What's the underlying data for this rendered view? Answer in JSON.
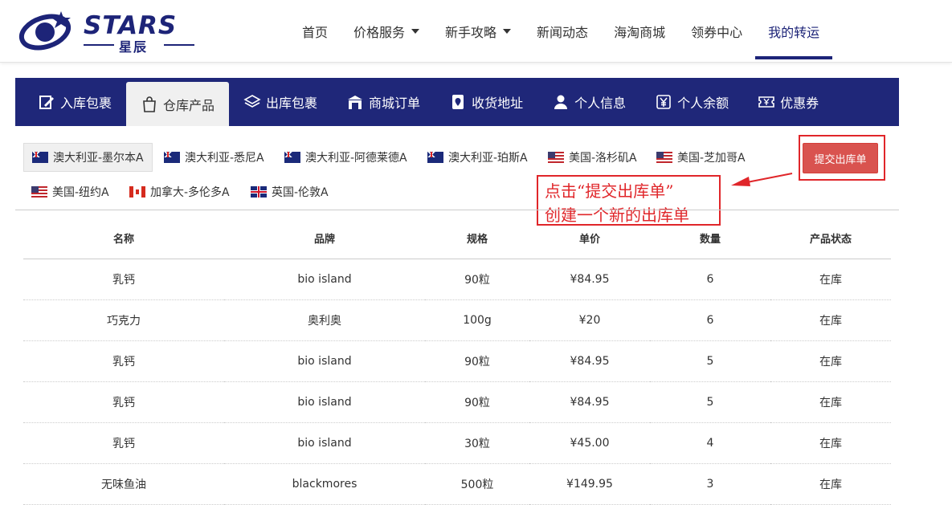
{
  "header": {
    "brand_word": "STARS",
    "brand_cn": "星辰",
    "nav": [
      {
        "label": "首页"
      },
      {
        "label": "价格服务"
      },
      {
        "label": "新手攻略"
      },
      {
        "label": "新闻动态"
      },
      {
        "label": "海淘商城"
      },
      {
        "label": "领券中心"
      },
      {
        "label": "我的转运"
      }
    ],
    "active_nav": "我的转运"
  },
  "tabs": [
    {
      "label": "入库包裹",
      "icon": "edit-icon"
    },
    {
      "label": "仓库产品",
      "icon": "bag-icon"
    },
    {
      "label": "出库包裹",
      "icon": "layers-icon"
    },
    {
      "label": "商城订单",
      "icon": "store-icon"
    },
    {
      "label": "收货地址",
      "icon": "location-icon"
    },
    {
      "label": "个人信息",
      "icon": "user-icon"
    },
    {
      "label": "个人余额",
      "icon": "yen-icon"
    },
    {
      "label": "优惠券",
      "icon": "coupon-icon"
    }
  ],
  "active_tab": "仓库产品",
  "warehouses": [
    {
      "label": "澳大利亚-墨尔本A",
      "flag": "au"
    },
    {
      "label": "澳大利亚-悉尼A",
      "flag": "au"
    },
    {
      "label": "澳大利亚-阿德莱德A",
      "flag": "au"
    },
    {
      "label": "澳大利亚-珀斯A",
      "flag": "au"
    },
    {
      "label": "美国-洛杉矶A",
      "flag": "us"
    },
    {
      "label": "美国-芝加哥A",
      "flag": "us"
    },
    {
      "label": "美国-纽约A",
      "flag": "us"
    },
    {
      "label": "加拿大-多伦多A",
      "flag": "ca"
    },
    {
      "label": "英国-伦敦A",
      "flag": "uk"
    }
  ],
  "active_warehouse": "澳大利亚-墨尔本A",
  "submit_button": "提交出库单",
  "annotation": {
    "line1": "点击“提交出库单”",
    "line2": "创建一个新的出库单",
    "color": "#e0262a"
  },
  "table": {
    "headers": [
      "名称",
      "品牌",
      "规格",
      "单价",
      "数量",
      "产品状态"
    ],
    "rows": [
      [
        "乳钙",
        "bio island",
        "90粒",
        "¥84.95",
        "6",
        "在库"
      ],
      [
        "巧克力",
        "奥利奥",
        "100g",
        "¥20",
        "6",
        "在库"
      ],
      [
        "乳钙",
        "bio island",
        "90粒",
        "¥84.95",
        "5",
        "在库"
      ],
      [
        "乳钙",
        "bio island",
        "90粒",
        "¥84.95",
        "5",
        "在库"
      ],
      [
        "乳钙",
        "bio island",
        "30粒",
        "¥45.00",
        "4",
        "在库"
      ],
      [
        "无味鱼油",
        "blackmores",
        "500粒",
        "¥149.95",
        "3",
        "在库"
      ]
    ]
  },
  "colors": {
    "brand": "#1d2478",
    "tabbar": "#1f2779",
    "submit": "#d9534f"
  }
}
